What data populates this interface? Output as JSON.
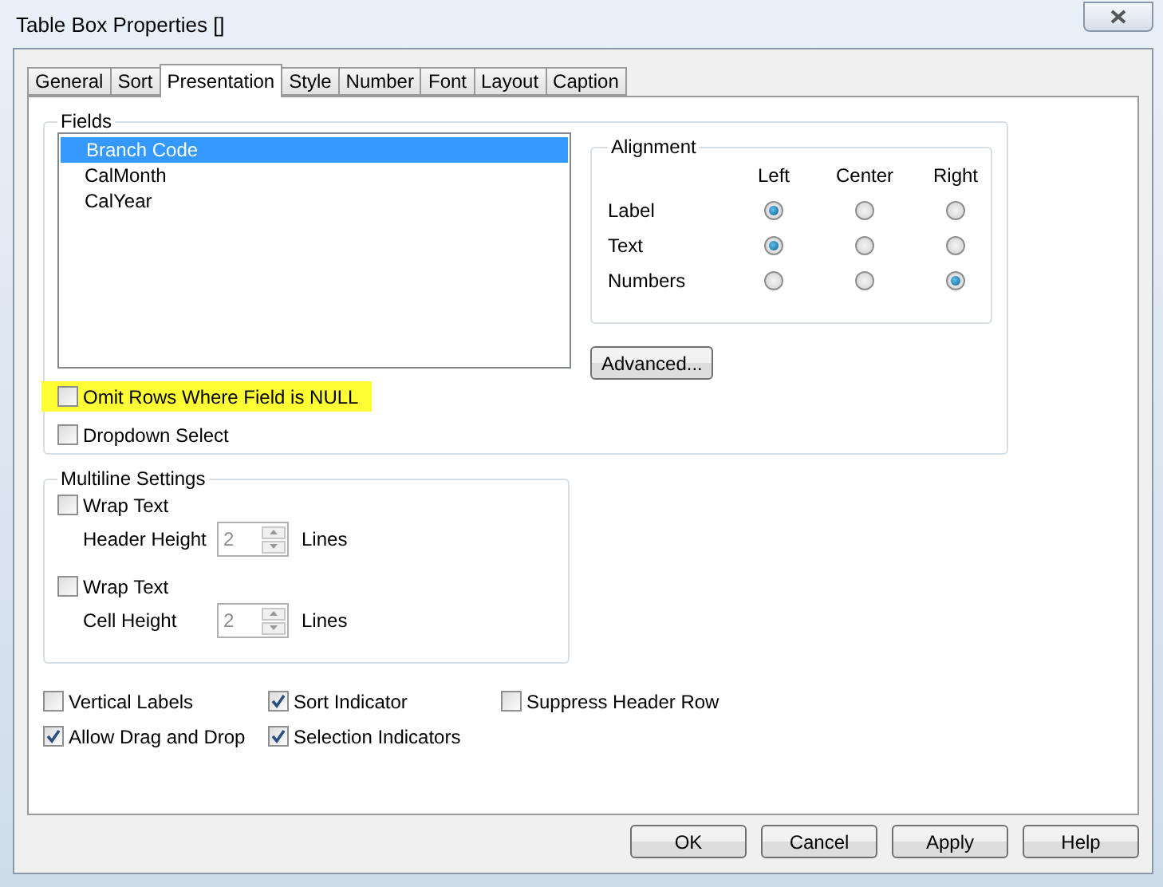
{
  "window": {
    "title": "Table Box Properties []"
  },
  "tabs": [
    {
      "label": "General",
      "selected": false
    },
    {
      "label": "Sort",
      "selected": false
    },
    {
      "label": "Presentation",
      "selected": true
    },
    {
      "label": "Style",
      "selected": false
    },
    {
      "label": "Number",
      "selected": false
    },
    {
      "label": "Font",
      "selected": false
    },
    {
      "label": "Layout",
      "selected": false
    },
    {
      "label": "Caption",
      "selected": false
    }
  ],
  "fields": {
    "title": "Fields",
    "items": [
      {
        "label": "Branch Code",
        "selected": true
      },
      {
        "label": "CalMonth",
        "selected": false
      },
      {
        "label": "CalYear",
        "selected": false
      }
    ],
    "options": [
      {
        "label": "Omit Rows Where Field is NULL",
        "checked": false,
        "highlighted": true
      },
      {
        "label": "Dropdown Select",
        "checked": false,
        "highlighted": false
      }
    ]
  },
  "alignment": {
    "title": "Alignment",
    "columns": [
      "Left",
      "Center",
      "Right"
    ],
    "rows": [
      {
        "label": "Label",
        "choices": [
          {
            "selected": true
          },
          {
            "selected": false
          },
          {
            "selected": false
          }
        ]
      },
      {
        "label": "Text",
        "choices": [
          {
            "selected": true
          },
          {
            "selected": false
          },
          {
            "selected": false
          }
        ]
      },
      {
        "label": "Numbers",
        "choices": [
          {
            "selected": false
          },
          {
            "selected": false
          },
          {
            "selected": true
          }
        ]
      }
    ]
  },
  "advanced_button": "Advanced...",
  "multiline": {
    "title": "Multiline Settings",
    "groups": [
      {
        "label": "Wrap Text",
        "checked": false,
        "height_label": "Header Height",
        "value": "2",
        "disabled": true,
        "unit": "Lines"
      },
      {
        "label": "Wrap Text",
        "checked": false,
        "height_label": "Cell Height",
        "value": "2",
        "disabled": true,
        "unit": "Lines"
      }
    ]
  },
  "options": [
    {
      "label": "Vertical Labels",
      "checked": false
    },
    {
      "label": "Sort Indicator",
      "checked": true
    },
    {
      "label": "Suppress Header Row",
      "checked": false
    },
    {
      "label": "Allow Drag and Drop",
      "checked": true
    },
    {
      "label": "Selection Indicators",
      "checked": true
    }
  ],
  "buttons": [
    "OK",
    "Cancel",
    "Apply",
    "Help"
  ]
}
